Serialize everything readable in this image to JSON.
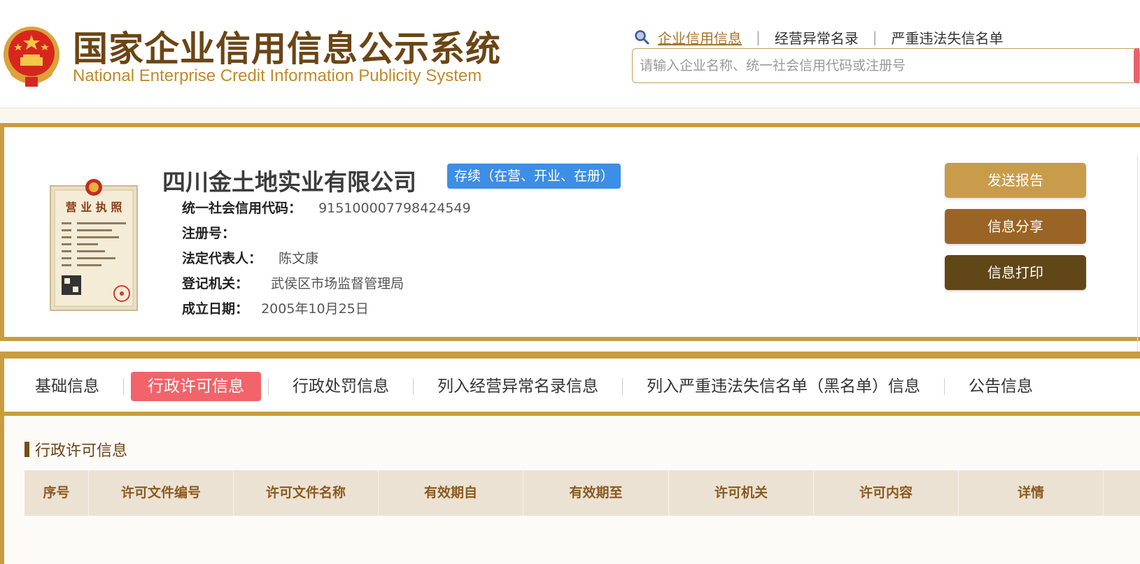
{
  "header": {
    "title_cn": "国家企业信用信息公示系统",
    "title_en": "National Enterprise Credit Information Publicity System",
    "links": [
      "企业信用信息",
      "经营异常名录",
      "严重违法失信名单"
    ],
    "search_placeholder": "请输入企业名称、统一社会信用代码或注册号"
  },
  "company": {
    "name": "四川金土地实业有限公司",
    "status": "存续（在营、开业、在册）",
    "fields": [
      {
        "label": "统一社会信用代码：",
        "value": "915100007798424549"
      },
      {
        "label": "注册号：",
        "value": ""
      },
      {
        "label": "法定代表人：",
        "value": "陈文康"
      },
      {
        "label": "登记机关：",
        "value": "武侯区市场监督管理局"
      },
      {
        "label": "成立日期：",
        "value": "2005年10月25日"
      }
    ],
    "license_text": "营 业 执 照",
    "actions": [
      "发送报告",
      "信息分享",
      "信息打印"
    ]
  },
  "tabs": [
    "基础信息",
    "行政许可信息",
    "行政处罚信息",
    "列入经营异常名录信息",
    "列入严重违法失信名单（黑名单）信息",
    "公告信息"
  ],
  "active_tab": 1,
  "section": {
    "title": "行政许可信息",
    "columns": [
      "序号",
      "许可文件编号",
      "许可文件名称",
      "有效期自",
      "有效期至",
      "许可机关",
      "许可内容",
      "详情"
    ]
  },
  "colors": {
    "brand_gold": "#c99c41",
    "status_blue": "#3d8ee6",
    "active_tab": "#f2636a"
  }
}
